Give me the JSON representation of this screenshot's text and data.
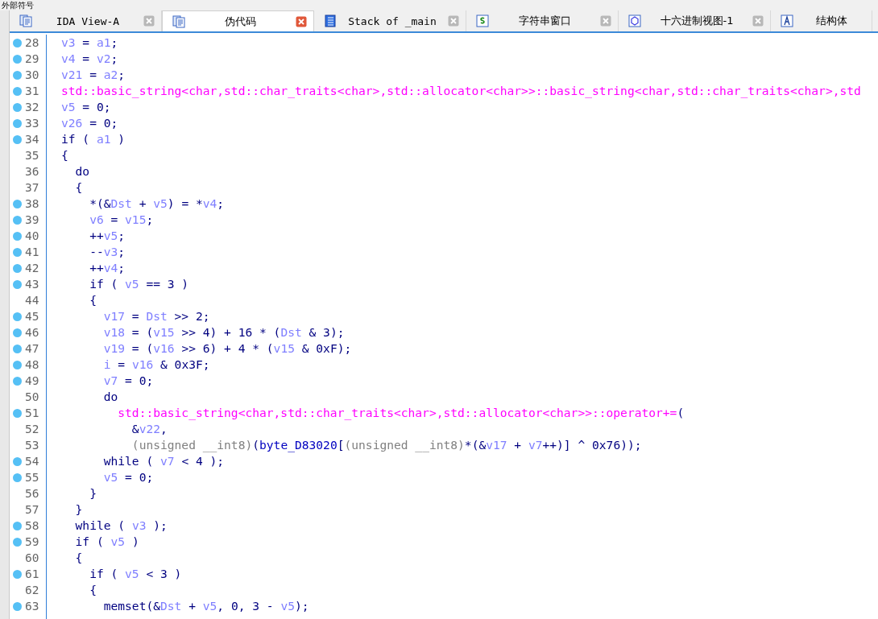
{
  "panel_title": "外部符号",
  "tabs": [
    {
      "label": "IDA View-A",
      "kind": "listing",
      "selected": false
    },
    {
      "label": "伪代码",
      "kind": "listing",
      "selected": true
    },
    {
      "label": "Stack of _main",
      "kind": "stack",
      "selected": false
    },
    {
      "label": "字符串窗口",
      "kind": "strings",
      "selected": false
    },
    {
      "label": "十六进制视图-1",
      "kind": "hex",
      "selected": false
    },
    {
      "label": "结构体",
      "kind": "struct",
      "selected": false
    }
  ],
  "lines": [
    {
      "number": "28",
      "breakpoint": true,
      "segments": [
        {
          "kind": "var",
          "text": "v3"
        },
        {
          "kind": "plain",
          "text": " = "
        },
        {
          "kind": "var",
          "text": "a1"
        },
        {
          "kind": "plain",
          "text": ";"
        }
      ]
    },
    {
      "number": "29",
      "breakpoint": true,
      "segments": [
        {
          "kind": "var",
          "text": "v4"
        },
        {
          "kind": "plain",
          "text": " = "
        },
        {
          "kind": "var",
          "text": "v2"
        },
        {
          "kind": "plain",
          "text": ";"
        }
      ]
    },
    {
      "number": "30",
      "breakpoint": true,
      "segments": [
        {
          "kind": "var",
          "text": "v21"
        },
        {
          "kind": "plain",
          "text": " = "
        },
        {
          "kind": "var",
          "text": "a2"
        },
        {
          "kind": "plain",
          "text": ";"
        }
      ]
    },
    {
      "number": "31",
      "breakpoint": true,
      "segments": [
        {
          "kind": "call",
          "text": "std::basic_string<char,std::char_traits<char>,std::allocator<char>>::basic_string<char,std::char_traits<char>,std"
        }
      ]
    },
    {
      "number": "32",
      "breakpoint": true,
      "segments": [
        {
          "kind": "var",
          "text": "v5"
        },
        {
          "kind": "plain",
          "text": " = 0;"
        }
      ]
    },
    {
      "number": "33",
      "breakpoint": true,
      "segments": [
        {
          "kind": "var",
          "text": "v26"
        },
        {
          "kind": "plain",
          "text": " = 0;"
        }
      ]
    },
    {
      "number": "34",
      "breakpoint": true,
      "segments": [
        {
          "kind": "plain",
          "text": "if ( "
        },
        {
          "kind": "var",
          "text": "a1"
        },
        {
          "kind": "plain",
          "text": " )"
        }
      ]
    },
    {
      "number": "35",
      "breakpoint": false,
      "segments": [
        {
          "kind": "plain",
          "text": "{"
        }
      ]
    },
    {
      "number": "36",
      "breakpoint": false,
      "segments": [
        {
          "kind": "plain",
          "text": "  do"
        }
      ]
    },
    {
      "number": "37",
      "breakpoint": false,
      "segments": [
        {
          "kind": "plain",
          "text": "  {"
        }
      ]
    },
    {
      "number": "38",
      "breakpoint": true,
      "segments": [
        {
          "kind": "plain",
          "text": "    *(&"
        },
        {
          "kind": "var",
          "text": "Dst"
        },
        {
          "kind": "plain",
          "text": " + "
        },
        {
          "kind": "var",
          "text": "v5"
        },
        {
          "kind": "plain",
          "text": ") = *"
        },
        {
          "kind": "var",
          "text": "v4"
        },
        {
          "kind": "plain",
          "text": ";"
        }
      ]
    },
    {
      "number": "39",
      "breakpoint": true,
      "segments": [
        {
          "kind": "var",
          "text": "    v6"
        },
        {
          "kind": "plain",
          "text": " = "
        },
        {
          "kind": "var",
          "text": "v15"
        },
        {
          "kind": "plain",
          "text": ";"
        }
      ]
    },
    {
      "number": "40",
      "breakpoint": true,
      "segments": [
        {
          "kind": "plain",
          "text": "    ++"
        },
        {
          "kind": "var",
          "text": "v5"
        },
        {
          "kind": "plain",
          "text": ";"
        }
      ]
    },
    {
      "number": "41",
      "breakpoint": true,
      "segments": [
        {
          "kind": "plain",
          "text": "    --"
        },
        {
          "kind": "var",
          "text": "v3"
        },
        {
          "kind": "plain",
          "text": ";"
        }
      ]
    },
    {
      "number": "42",
      "breakpoint": true,
      "segments": [
        {
          "kind": "plain",
          "text": "    ++"
        },
        {
          "kind": "var",
          "text": "v4"
        },
        {
          "kind": "plain",
          "text": ";"
        }
      ]
    },
    {
      "number": "43",
      "breakpoint": true,
      "segments": [
        {
          "kind": "plain",
          "text": "    if ( "
        },
        {
          "kind": "var",
          "text": "v5"
        },
        {
          "kind": "plain",
          "text": " == 3 )"
        }
      ]
    },
    {
      "number": "44",
      "breakpoint": false,
      "segments": [
        {
          "kind": "plain",
          "text": "    {"
        }
      ]
    },
    {
      "number": "45",
      "breakpoint": true,
      "segments": [
        {
          "kind": "var",
          "text": "      v17"
        },
        {
          "kind": "plain",
          "text": " = "
        },
        {
          "kind": "var",
          "text": "Dst"
        },
        {
          "kind": "plain",
          "text": " >> 2;"
        }
      ]
    },
    {
      "number": "46",
      "breakpoint": true,
      "segments": [
        {
          "kind": "var",
          "text": "      v18"
        },
        {
          "kind": "plain",
          "text": " = ("
        },
        {
          "kind": "var",
          "text": "v15"
        },
        {
          "kind": "plain",
          "text": " >> 4) + 16 * ("
        },
        {
          "kind": "var",
          "text": "Dst"
        },
        {
          "kind": "plain",
          "text": " & 3);"
        }
      ]
    },
    {
      "number": "47",
      "breakpoint": true,
      "segments": [
        {
          "kind": "var",
          "text": "      v19"
        },
        {
          "kind": "plain",
          "text": " = ("
        },
        {
          "kind": "var",
          "text": "v16"
        },
        {
          "kind": "plain",
          "text": " >> 6) + 4 * ("
        },
        {
          "kind": "var",
          "text": "v15"
        },
        {
          "kind": "plain",
          "text": " & 0xF);"
        }
      ]
    },
    {
      "number": "48",
      "breakpoint": true,
      "segments": [
        {
          "kind": "var",
          "text": "      i"
        },
        {
          "kind": "plain",
          "text": " = "
        },
        {
          "kind": "var",
          "text": "v16"
        },
        {
          "kind": "plain",
          "text": " & 0x3F;"
        }
      ]
    },
    {
      "number": "49",
      "breakpoint": true,
      "segments": [
        {
          "kind": "var",
          "text": "      v7"
        },
        {
          "kind": "plain",
          "text": " = 0;"
        }
      ]
    },
    {
      "number": "50",
      "breakpoint": false,
      "segments": [
        {
          "kind": "plain",
          "text": "      do"
        }
      ]
    },
    {
      "number": "51",
      "breakpoint": true,
      "segments": [
        {
          "kind": "call",
          "text": "        std::basic_string<char,std::char_traits<char>,std::allocator<char>>::operator+="
        },
        {
          "kind": "plain",
          "text": "("
        }
      ]
    },
    {
      "number": "52",
      "breakpoint": false,
      "segments": [
        {
          "kind": "plain",
          "text": "          &"
        },
        {
          "kind": "var",
          "text": "v22"
        },
        {
          "kind": "plain",
          "text": ","
        }
      ]
    },
    {
      "number": "53",
      "breakpoint": false,
      "segments": [
        {
          "kind": "cast",
          "text": "          (unsigned __int8)"
        },
        {
          "kind": "plain",
          "text": "("
        },
        {
          "kind": "name",
          "text": "byte_D83020"
        },
        {
          "kind": "plain",
          "text": "["
        },
        {
          "kind": "cast",
          "text": "(unsigned __int8)"
        },
        {
          "kind": "plain",
          "text": "*(&"
        },
        {
          "kind": "var",
          "text": "v17"
        },
        {
          "kind": "plain",
          "text": " + "
        },
        {
          "kind": "var",
          "text": "v7"
        },
        {
          "kind": "plain",
          "text": "++)] ^ 0x76));"
        }
      ]
    },
    {
      "number": "54",
      "breakpoint": true,
      "segments": [
        {
          "kind": "plain",
          "text": "      while ( "
        },
        {
          "kind": "var",
          "text": "v7"
        },
        {
          "kind": "plain",
          "text": " < 4 );"
        }
      ]
    },
    {
      "number": "55",
      "breakpoint": true,
      "segments": [
        {
          "kind": "var",
          "text": "      v5"
        },
        {
          "kind": "plain",
          "text": " = 0;"
        }
      ]
    },
    {
      "number": "56",
      "breakpoint": false,
      "segments": [
        {
          "kind": "plain",
          "text": "    }"
        }
      ]
    },
    {
      "number": "57",
      "breakpoint": false,
      "segments": [
        {
          "kind": "plain",
          "text": "  }"
        }
      ]
    },
    {
      "number": "58",
      "breakpoint": true,
      "segments": [
        {
          "kind": "plain",
          "text": "  while ( "
        },
        {
          "kind": "var",
          "text": "v3"
        },
        {
          "kind": "plain",
          "text": " );"
        }
      ]
    },
    {
      "number": "59",
      "breakpoint": true,
      "segments": [
        {
          "kind": "plain",
          "text": "  if ( "
        },
        {
          "kind": "var",
          "text": "v5"
        },
        {
          "kind": "plain",
          "text": " )"
        }
      ]
    },
    {
      "number": "60",
      "breakpoint": false,
      "segments": [
        {
          "kind": "plain",
          "text": "  {"
        }
      ]
    },
    {
      "number": "61",
      "breakpoint": true,
      "segments": [
        {
          "kind": "plain",
          "text": "    if ( "
        },
        {
          "kind": "var",
          "text": "v5"
        },
        {
          "kind": "plain",
          "text": " < 3 )"
        }
      ]
    },
    {
      "number": "62",
      "breakpoint": false,
      "segments": [
        {
          "kind": "plain",
          "text": "    {"
        }
      ]
    },
    {
      "number": "63",
      "breakpoint": true,
      "segments": [
        {
          "kind": "plain",
          "text": "      memset(&"
        },
        {
          "kind": "var",
          "text": "Dst"
        },
        {
          "kind": "plain",
          "text": " + "
        },
        {
          "kind": "var",
          "text": "v5"
        },
        {
          "kind": "plain",
          "text": ", 0, 3 - "
        },
        {
          "kind": "var",
          "text": "v5"
        },
        {
          "kind": "plain",
          "text": ");"
        }
      ]
    }
  ]
}
